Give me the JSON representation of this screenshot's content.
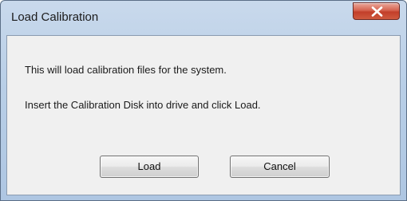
{
  "window": {
    "title": "Load Calibration",
    "close_icon": "close-icon"
  },
  "message": {
    "line1": "This will load calibration files for the system.",
    "line2": "Insert the Calibration Disk into drive and click Load."
  },
  "buttons": {
    "load_label": "Load",
    "cancel_label": "Cancel"
  },
  "colors": {
    "title_bar": "#b9cfe7",
    "close_button": "#c23f2a",
    "client_background": "#f0f0f0"
  }
}
